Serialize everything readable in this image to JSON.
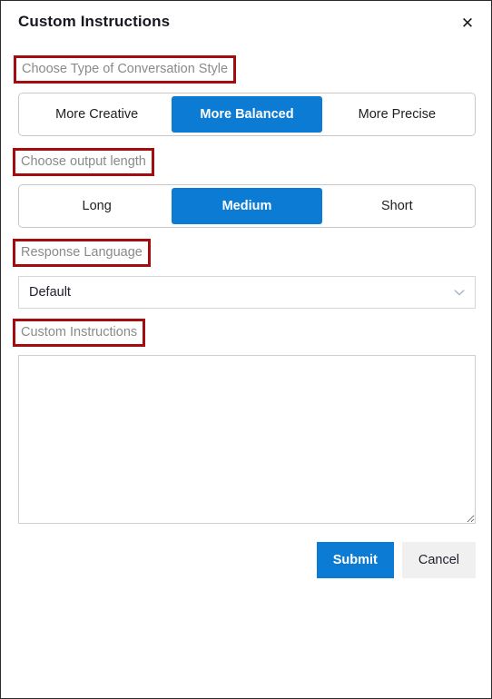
{
  "dialog": {
    "title": "Custom Instructions",
    "close_icon": "close-icon",
    "close_glyph": "✕"
  },
  "colors": {
    "accent_blue": "#0b7bd4",
    "annotation_red": "#a40d0d",
    "label_gray": "#8a8a8a",
    "cancel_gray": "#f0f0f0",
    "border_gray": "#c8c8c8",
    "panel_border": "#2b2b2b"
  },
  "fields": {
    "conversation_style": {
      "label": "Choose Type of Conversation Style",
      "annotated": true,
      "options": [
        "More Creative",
        "More Balanced",
        "More Precise"
      ],
      "selected": "More Balanced",
      "selected_index": 1
    },
    "output_length": {
      "label": "Choose output length",
      "annotated": true,
      "options": [
        "Long",
        "Medium",
        "Short"
      ],
      "selected": "Medium",
      "selected_index": 1
    },
    "response_language": {
      "label": "Response Language",
      "annotated": true,
      "value": "Default",
      "chevron_icon": "chevron-down-icon"
    },
    "custom_instructions": {
      "label": "Custom Instructions",
      "annotated": true,
      "value": "",
      "placeholder": ""
    }
  },
  "actions": {
    "submit_label": "Submit",
    "cancel_label": "Cancel"
  }
}
